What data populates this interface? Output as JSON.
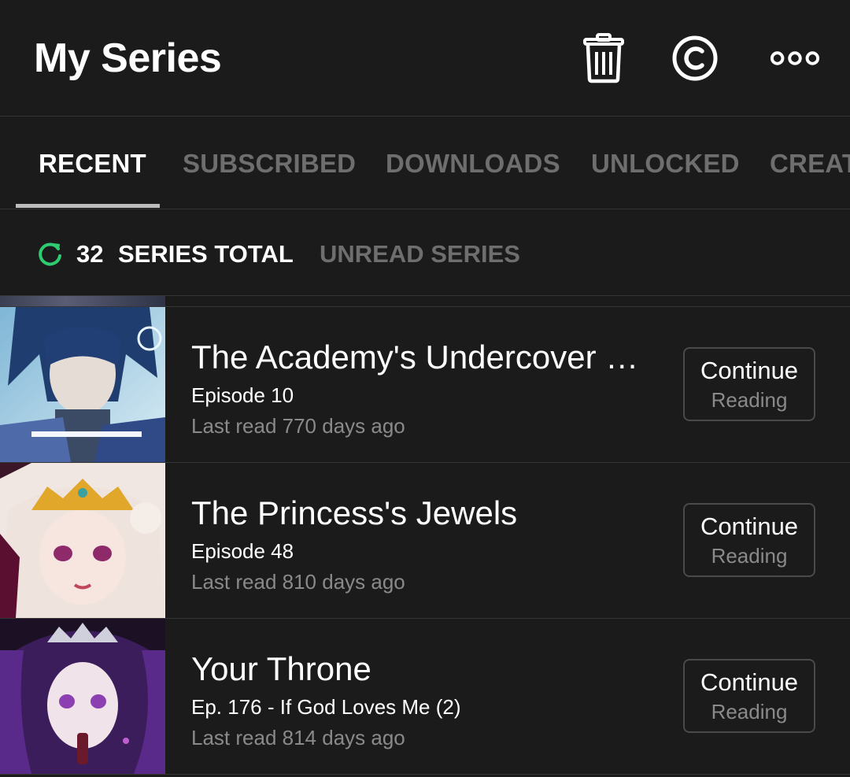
{
  "header": {
    "title": "My Series",
    "icons": [
      "trash-icon",
      "copyright-icon",
      "more-icon"
    ]
  },
  "tabs": [
    {
      "label": "RECENT",
      "active": true
    },
    {
      "label": "SUBSCRIBED",
      "active": false
    },
    {
      "label": "DOWNLOADS",
      "active": false
    },
    {
      "label": "UNLOCKED",
      "active": false
    },
    {
      "label": "CREAT",
      "active": false
    }
  ],
  "filter": {
    "count": "32",
    "total_label": "SERIES TOTAL",
    "unread_label": "UNREAD SERIES",
    "accent": "#2ecc71"
  },
  "series": [
    {
      "title": "The Academy's Undercover Pr...",
      "episode": "Episode 10",
      "last_read": "Last read 770 days ago",
      "button_line1": "Continue",
      "button_line2": "Reading"
    },
    {
      "title": "The Princess's Jewels",
      "episode": "Episode 48",
      "last_read": "Last read 810 days ago",
      "button_line1": "Continue",
      "button_line2": "Reading"
    },
    {
      "title": "Your Throne",
      "episode": "Ep. 176 - If God Loves Me (2)",
      "last_read": "Last read 814 days ago",
      "button_line1": "Continue",
      "button_line2": "Reading"
    }
  ],
  "colors": {
    "background": "#1b1b1b",
    "divider": "#363636",
    "inactive_text": "#6e6e6e",
    "secondary_text": "#8a8a8a"
  }
}
